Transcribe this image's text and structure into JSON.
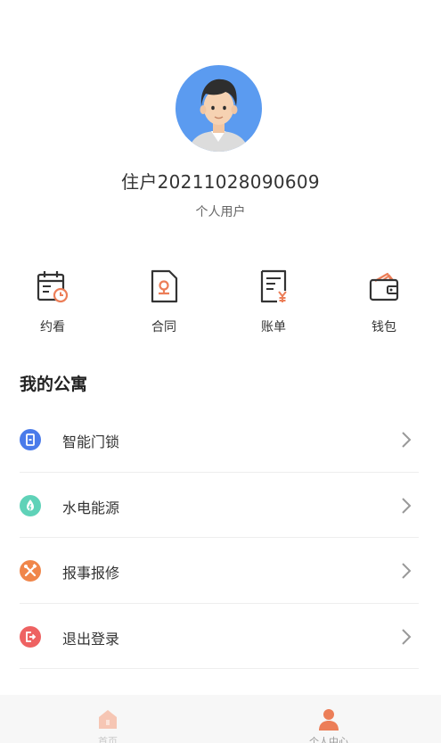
{
  "profile": {
    "name": "住户20211028090609",
    "type": "个人用户"
  },
  "actions": [
    {
      "label": "约看",
      "icon": "calendar-clock-icon"
    },
    {
      "label": "合同",
      "icon": "contract-icon"
    },
    {
      "label": "账单",
      "icon": "bill-icon"
    },
    {
      "label": "钱包",
      "icon": "wallet-icon"
    }
  ],
  "section": {
    "title": "我的公寓"
  },
  "menu": [
    {
      "label": "智能门锁",
      "icon": "door-lock-icon",
      "color": "#4a7bea"
    },
    {
      "label": "水电能源",
      "icon": "energy-icon",
      "color": "#5fd2b8"
    },
    {
      "label": "报事报修",
      "icon": "repair-tools-icon",
      "color": "#f0864a"
    },
    {
      "label": "退出登录",
      "icon": "logout-icon",
      "color": "#ee6262"
    }
  ],
  "tabbar": [
    {
      "label": "首页",
      "icon": "home-icon",
      "active": false
    },
    {
      "label": "个人中心",
      "icon": "person-icon",
      "active": true
    }
  ],
  "colors": {
    "accent": "#ec7e58",
    "avatar_bg": "#5b9bf0",
    "icon_dark": "#333333"
  }
}
